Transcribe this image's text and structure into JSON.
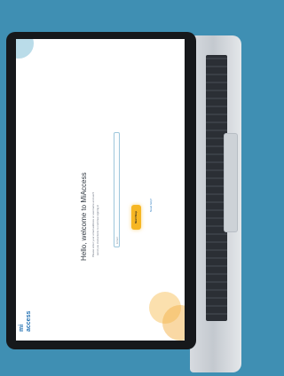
{
  "app": {
    "logo_line1": "mi",
    "logo_line2": "access"
  },
  "login": {
    "title": "Hello, welcome to MiAccess",
    "description_line1": "Please enter your email address or username and we'll",
    "description_line2": "send you instructions to continue signing in",
    "input_placeholder": "Email",
    "button_label": "Next Step",
    "link_label": "Need help?"
  }
}
